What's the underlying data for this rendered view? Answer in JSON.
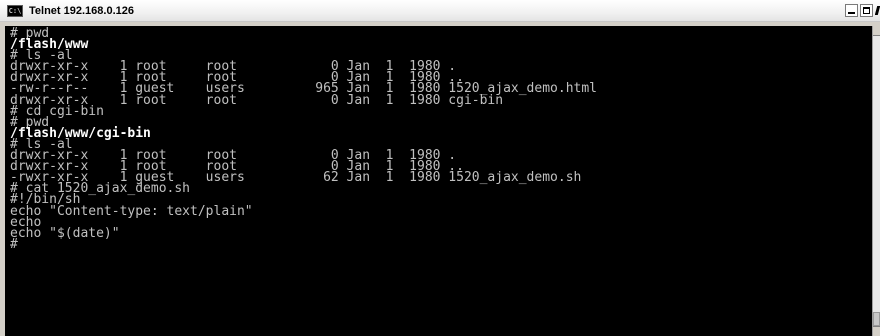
{
  "window": {
    "title": "Telnet 192.168.0.126",
    "icon_name": "console-icon",
    "icon_text": "C:\\",
    "controls": [
      "minimize",
      "maximize",
      "close"
    ]
  },
  "terminal": {
    "background": "#000000",
    "foreground": "#c0c0c0",
    "highlight": "#ffffff",
    "lines": [
      {
        "text": "# pwd",
        "bright": false
      },
      {
        "text": "/flash/www",
        "bright": true
      },
      {
        "text": "# ls -al",
        "bright": false
      },
      {
        "text": "drwxr-xr-x    1 root     root            0 Jan  1  1980 .",
        "bright": false
      },
      {
        "text": "drwxr-xr-x    1 root     root            0 Jan  1  1980 ..",
        "bright": false
      },
      {
        "text": "-rw-r--r--    1 guest    users         965 Jan  1  1980 1520_ajax_demo.html",
        "bright": false
      },
      {
        "text": "drwxr-xr-x    1 root     root            0 Jan  1  1980 cgi-bin",
        "bright": false
      },
      {
        "text": "# cd cgi-bin",
        "bright": false
      },
      {
        "text": "# pwd",
        "bright": false
      },
      {
        "text": "/flash/www/cgi-bin",
        "bright": true
      },
      {
        "text": "# ls -al",
        "bright": false
      },
      {
        "text": "drwxr-xr-x    1 root     root            0 Jan  1  1980 .",
        "bright": false
      },
      {
        "text": "drwxr-xr-x    1 root     root            0 Jan  1  1980 ..",
        "bright": false
      },
      {
        "text": "-rwxr-xr-x    1 guest    users          62 Jan  1  1980 1520_ajax_demo.sh",
        "bright": false
      },
      {
        "text": "# cat 1520_ajax_demo.sh",
        "bright": false
      },
      {
        "text": "#!/bin/sh",
        "bright": false
      },
      {
        "text": "echo \"Content-type: text/plain\"",
        "bright": false
      },
      {
        "text": "echo",
        "bright": false
      },
      {
        "text": "echo \"$(date)\"",
        "bright": false
      },
      {
        "text": "#",
        "bright": false
      }
    ]
  }
}
